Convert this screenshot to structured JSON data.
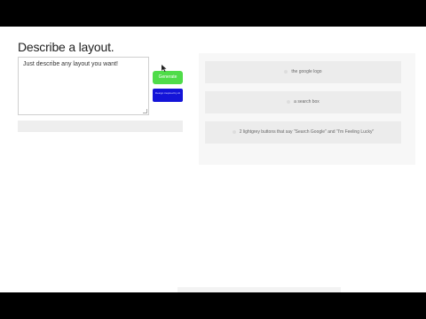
{
  "heading": "Describe a layout.",
  "prompt": {
    "value": "Just describe any layout you want!"
  },
  "buttons": {
    "generate": "Generate",
    "secondary": "Design inspired by AI"
  },
  "results": [
    {
      "label": "the google logo"
    },
    {
      "label": "a search box"
    },
    {
      "label": "2 lightgrey buttons that say \"Search Google\" and \"I'm Feeling Lucky\""
    }
  ],
  "colors": {
    "generate": "#4fdc49",
    "secondary": "#1414d8",
    "result_bg": "#ececec",
    "letterbox": "#000000"
  },
  "icons": {
    "cursor": "mouse-pointer-icon",
    "result": "dot-icon"
  }
}
